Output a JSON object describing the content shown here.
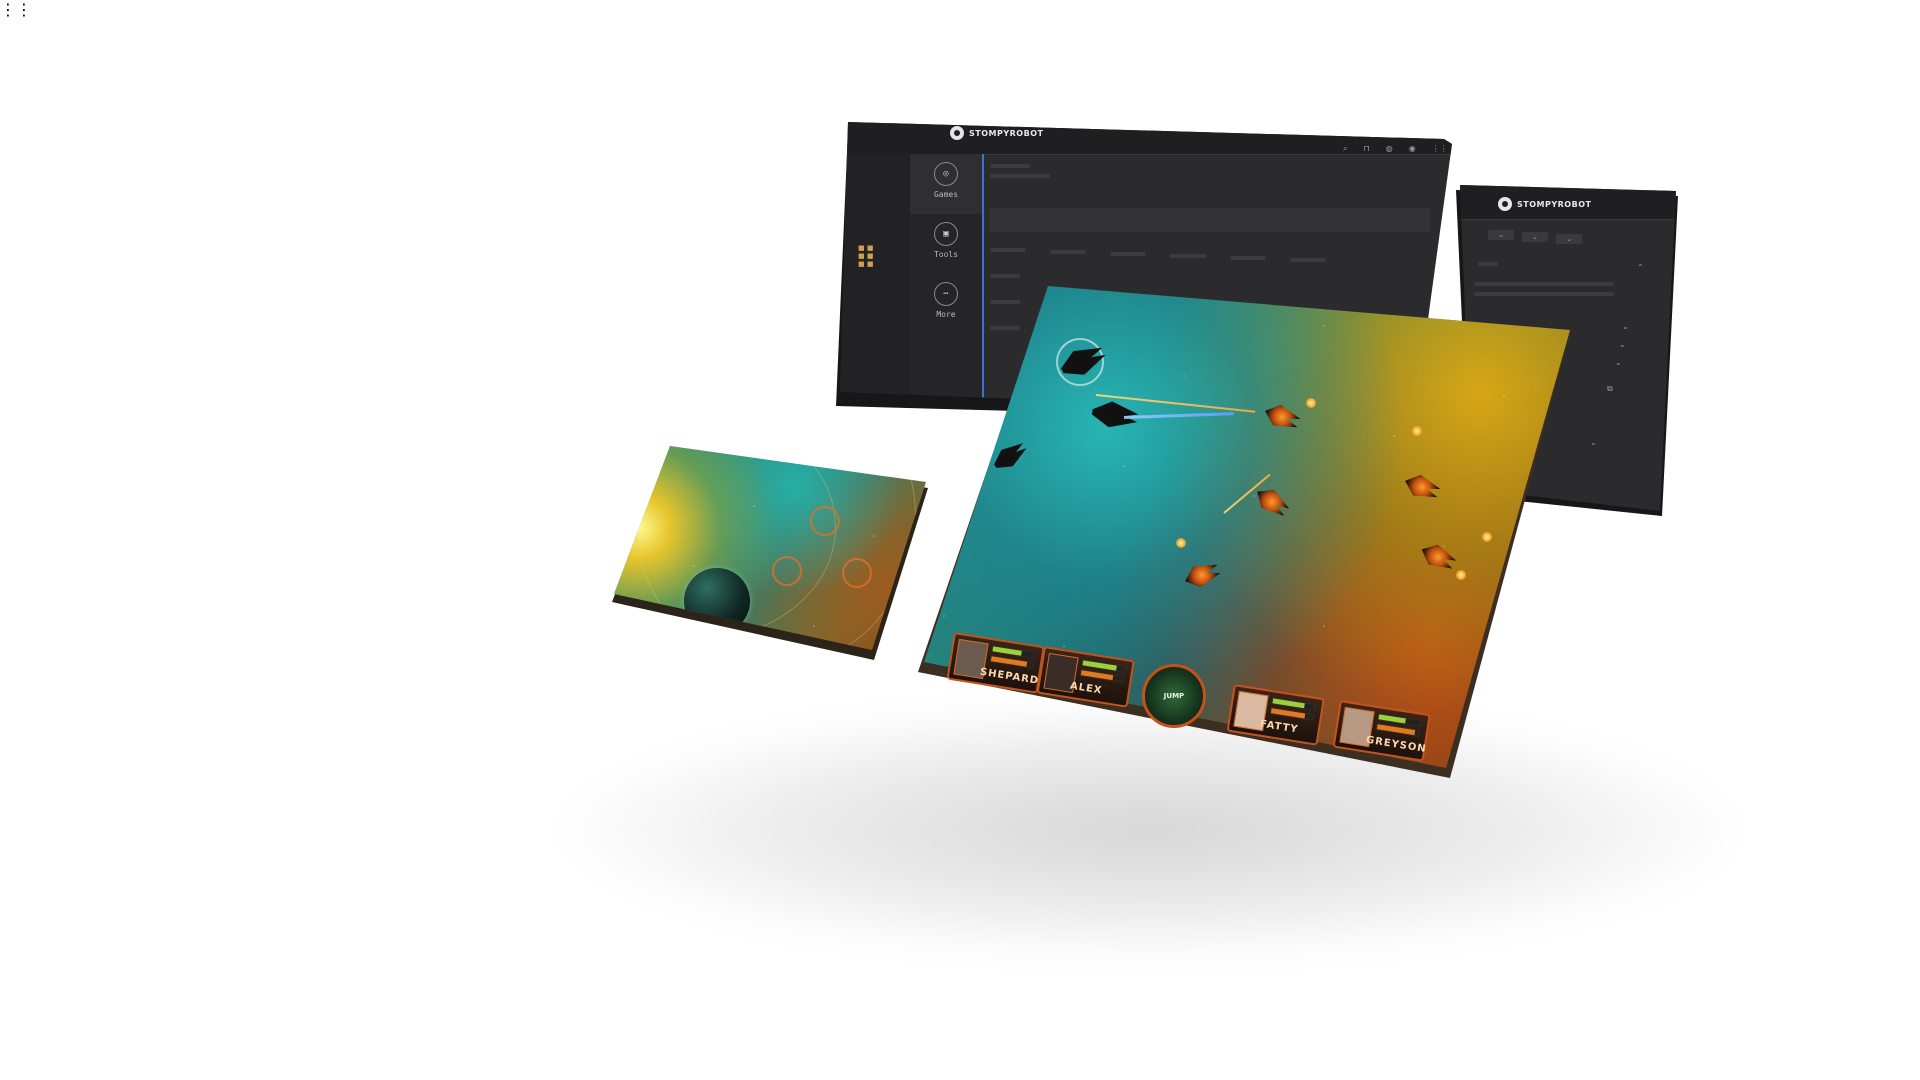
{
  "dashboard": {
    "brand": "STOMPYROBOT",
    "nav": [
      {
        "label": "Games",
        "icon": "gamepad-icon"
      },
      {
        "label": "Tools",
        "icon": "briefcase-icon"
      },
      {
        "label": "More",
        "icon": "more-icon"
      }
    ],
    "top_icons": [
      "search-icon",
      "cart-icon",
      "globe-icon",
      "user-icon",
      "apps-icon"
    ]
  },
  "right_panel": {
    "brand": "STOMPYROBOT"
  },
  "game_hud": {
    "crew": [
      {
        "name": "SHEPARD"
      },
      {
        "name": "ALEX"
      },
      {
        "name": "FATTY"
      },
      {
        "name": "GREYSON"
      }
    ],
    "jump_label": "JUMP"
  },
  "colors": {
    "accent_blue": "#3f6fd8",
    "hud_orange": "#c4521c",
    "panel_dark": "#2b2b2d"
  }
}
